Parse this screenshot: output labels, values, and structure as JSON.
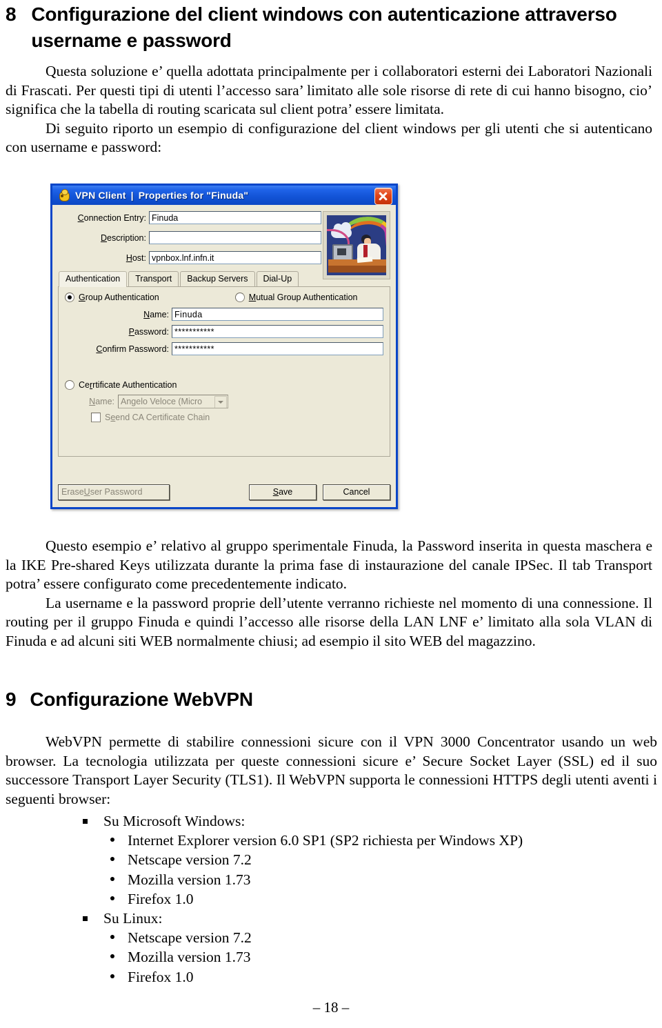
{
  "document": {
    "section8": {
      "number": "8",
      "title": "Configurazione del client windows con autenticazione attraverso username e password",
      "paragraph1": "Questa soluzione e’ quella adottata principalmente per i collaboratori esterni dei Laboratori Nazionali di Frascati. Per questi tipi di utenti l’accesso sara’ limitato alle sole risorse di rete di cui hanno bisogno, cio’ significa che la tabella di routing scaricata sul client potra’ essere limitata.",
      "paragraph2": "Di seguito riporto un esempio di configurazione del client windows per gli utenti che si autenticano con username e password:",
      "caption1": "Questo esempio e’ relativo al gruppo sperimentale Finuda, la Password inserita in questa maschera e la IKE Pre-shared Keys utilizzata durante la prima fase di instaurazione del canale IPSec. Il tab Transport potra’ essere configurato come precedentemente indicato.",
      "caption2": "La username e la password proprie dell’utente verranno richieste nel momento di una connessione. Il routing per il gruppo Finuda e quindi l’accesso alle risorse della LAN LNF e’ limitato alla sola VLAN di Finuda e ad alcuni siti WEB normalmente chiusi; ad esempio il sito WEB del magazzino."
    },
    "section9": {
      "number": "9",
      "title": "Configurazione WebVPN",
      "paragraph1": "WebVPN permette di stabilire connessioni sicure con il VPN 3000 Concentrator usando un web browser. La tecnologia utilizzata per queste connessioni sicure e’ Secure Socket Layer (SSL) ed il suo successore Transport Layer Security (TLS1). Il WebVPN supporta le connessioni HTTPS degli utenti aventi i seguenti browser:",
      "browser_list": [
        {
          "platform": "Su Microsoft Windows:",
          "browsers": [
            "Internet Explorer version 6.0 SP1 (SP2 richiesta per Windows XP)",
            "Netscape version 7.2",
            "Mozilla version 1.73",
            "Firefox 1.0"
          ]
        },
        {
          "platform": "Su Linux:",
          "browsers": [
            "Netscape version 7.2",
            "Mozilla version 1.73",
            "Firefox 1.0"
          ]
        }
      ]
    },
    "footer": "– 18 –"
  },
  "vpn_dialog": {
    "titlebar": {
      "app_name": "VPN Client",
      "separator": "|",
      "document_title": "Properties for \"Finuda\"",
      "close_label": "×",
      "icon": "vpn-client-icon",
      "background_color": "#1f63e8",
      "close_color": "#e1451a"
    },
    "top_fields": [
      {
        "label_prefix": "C",
        "label_rest": "onnection Entry:",
        "value": "Finuda"
      },
      {
        "label_prefix": "D",
        "label_rest": "escription:",
        "value": ""
      },
      {
        "label_prefix": "H",
        "label_rest": "ost:",
        "value": "vpnbox.lnf.infn.it"
      }
    ],
    "illustration": "vpn-connection-illustration",
    "tabs": [
      {
        "label": "Authentication",
        "active": true
      },
      {
        "label": "Transport",
        "active": false
      },
      {
        "label": "Backup Servers",
        "active": false
      },
      {
        "label": "Dial-Up",
        "active": false
      }
    ],
    "authentication_tab": {
      "group_auth": {
        "label_prefix": "G",
        "label_rest": "roup Authentication",
        "selected": true
      },
      "mutual_group_auth": {
        "label_prefix": "M",
        "label_rest": "utual Group Authentication",
        "selected": false
      },
      "fields": [
        {
          "label_prefix": "N",
          "label_rest": "ame:",
          "value": "Finuda"
        },
        {
          "label_prefix": "P",
          "label_rest": "assword:",
          "value": "***********"
        },
        {
          "label_prefix": "C",
          "label_rest": "onfirm Password:",
          "value": "***********"
        }
      ],
      "certificate_auth": {
        "label_prefix": "Ce",
        "label_rest": "rtificate Authentication",
        "selected": false,
        "name_label_prefix": "N",
        "name_label_rest": "ame:",
        "name_value": "Angelo Veloce (Micro",
        "send_chain_prefix": "S",
        "send_chain_rest": "end CA Certificate Chain",
        "send_chain_checked": false
      }
    },
    "buttons": {
      "erase": {
        "prefix": "Erase ",
        "accel": "U",
        "rest": "ser Password",
        "enabled": false
      },
      "save": {
        "prefix": "",
        "accel": "S",
        "rest": "ave",
        "enabled": true
      },
      "cancel": {
        "prefix": "",
        "accel": "",
        "rest": "Cancel",
        "enabled": true
      }
    }
  }
}
